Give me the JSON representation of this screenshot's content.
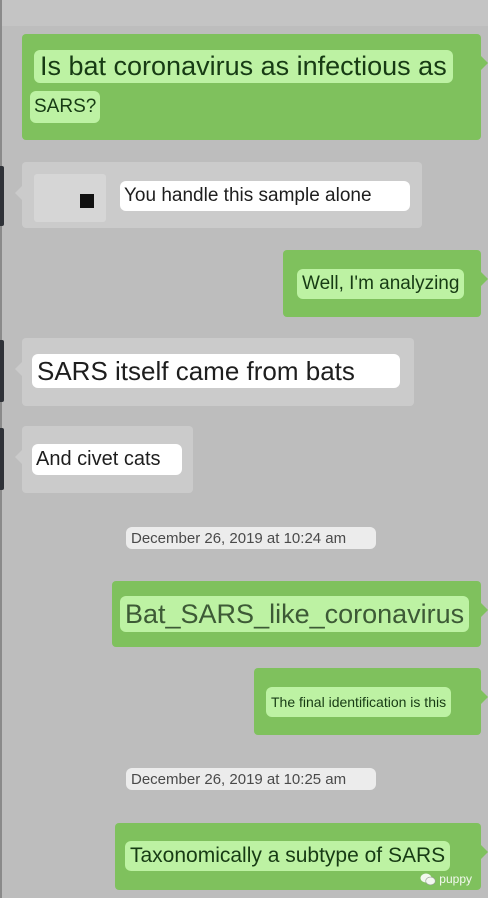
{
  "messages": [
    {
      "side": "right",
      "text_line1": "Is bat coronavirus as infectious as",
      "text_line2": "SARS?"
    },
    {
      "side": "left",
      "text": "You handle this sample alone"
    },
    {
      "side": "right",
      "text": "Well, I'm analyzing"
    },
    {
      "side": "left",
      "text": "SARS itself came from bats"
    },
    {
      "side": "left",
      "text": "And civet cats"
    },
    {
      "type": "timestamp",
      "text": "December 26, 2019 at 10:24 am"
    },
    {
      "side": "right",
      "text": "Bat_SARS_like_coronavirus"
    },
    {
      "side": "right",
      "text": "The final identification is this"
    },
    {
      "type": "timestamp",
      "text": "December 26, 2019 at 10:25 am"
    },
    {
      "side": "right",
      "text": "Taxonomically a subtype of SARS"
    }
  ],
  "watermark": {
    "text": "puppy",
    "icon": "wechat-icon"
  },
  "colors": {
    "background": "#bdbdbd",
    "sent_bubble": "#7fc15d",
    "sent_highlight": "#bdf2a3",
    "received_bubble": "#cbcbcb",
    "received_highlight": "#ffffff"
  }
}
